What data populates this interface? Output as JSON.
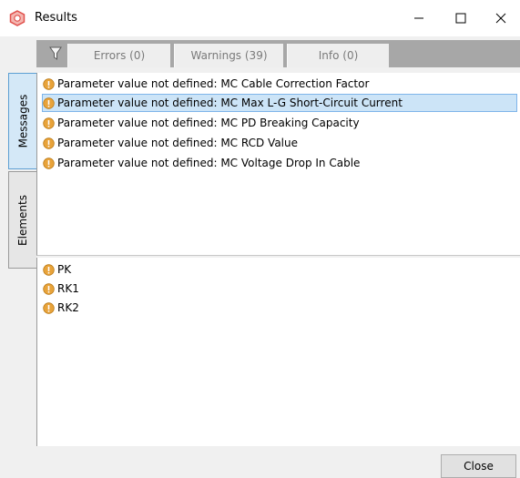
{
  "window": {
    "title": "Results"
  },
  "filters": {
    "errors": "Errors (0)",
    "warnings": "Warnings (39)",
    "info": "Info (0)"
  },
  "tabs": {
    "messages": "Messages",
    "elements": "Elements"
  },
  "messages": [
    "Parameter value not defined: MC Cable Correction Factor",
    "Parameter value not defined: MC Max L-G Short-Circuit Current",
    "Parameter value not defined: MC PD Breaking Capacity",
    "Parameter value not defined: MC RCD Value",
    "Parameter value not defined: MC Voltage Drop In Cable"
  ],
  "selected_message_index": 1,
  "elements": [
    "PK",
    "RK1",
    "RK2"
  ],
  "footer": {
    "close_label": "Close"
  },
  "colors": {
    "warning": "#e8a33a",
    "selection": "#cce4f7",
    "accent": "#e0504c"
  }
}
